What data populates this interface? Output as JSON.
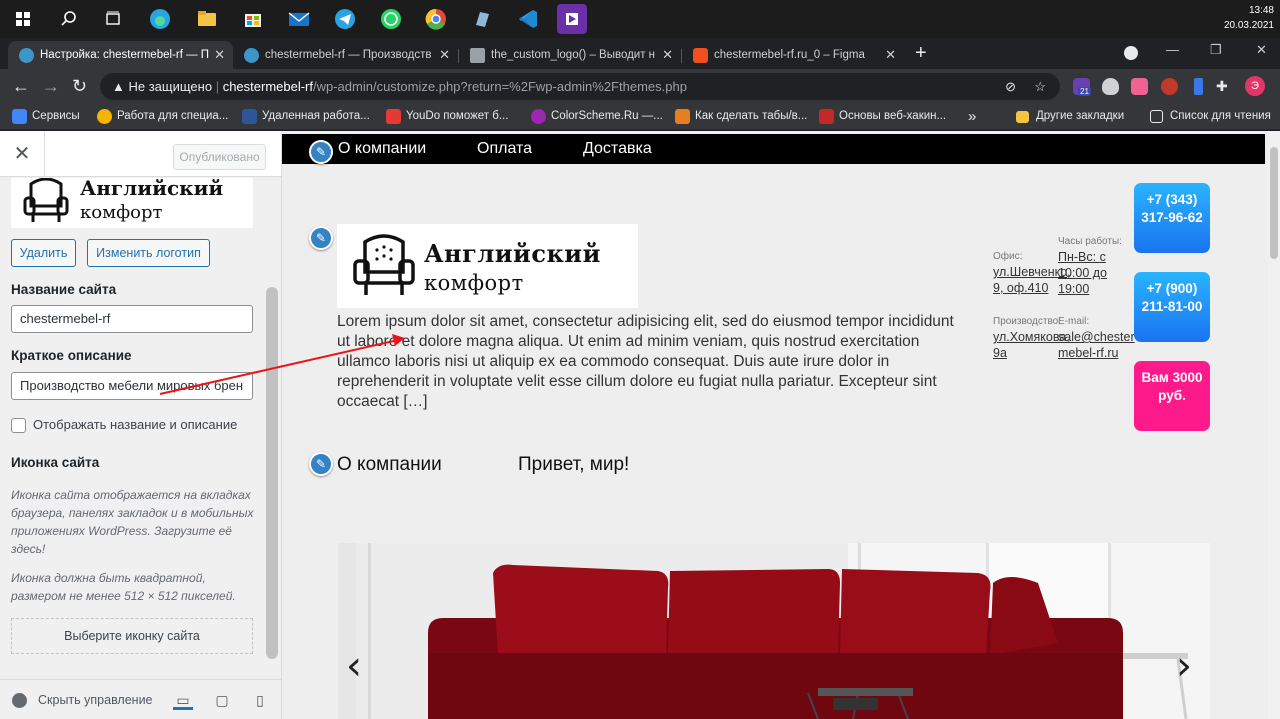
{
  "taskbar": {
    "time": "13:48",
    "date": "20.03.2021",
    "apps": [
      {
        "icon": "windows-start-icon",
        "color": "#ffffff"
      },
      {
        "icon": "search-icon",
        "color": "#ffffff"
      },
      {
        "icon": "task-view-icon",
        "color": "#ffffff"
      },
      {
        "icon": "edge-icon",
        "color": "#2ba5e0"
      },
      {
        "icon": "file-explorer-icon",
        "color": "#f5c443"
      },
      {
        "icon": "store-icon",
        "color": "#f0f0f0"
      },
      {
        "icon": "mail-icon",
        "color": "#1a73c8"
      },
      {
        "icon": "telegram-icon",
        "color": "#2aa3de"
      },
      {
        "icon": "whatsapp-icon",
        "color": "#25d366"
      },
      {
        "icon": "chrome-icon",
        "color": "#dd4b39"
      },
      {
        "icon": "notes-icon",
        "color": "#8fb8d8"
      },
      {
        "icon": "vscode-icon",
        "color": "#1f8ad2"
      },
      {
        "icon": "media-player-icon",
        "color": "#6b2fa8"
      }
    ]
  },
  "browser": {
    "tabs": [
      {
        "label": "Настройка: chestermebel-rf — П",
        "active": true,
        "fav_color": "#3c96c8"
      },
      {
        "label": "chestermebel-rf — Производств",
        "active": false,
        "fav_color": "#3c96c8"
      },
      {
        "label": "the_custom_logo() – Выводит н",
        "active": false,
        "fav_color": "#9aa0a6"
      },
      {
        "label": "chestermebel-rf.ru_0 – Figma",
        "active": false,
        "fav_color": "#f24e1e"
      }
    ],
    "new_tab_glyph": "+",
    "address": {
      "warning": "Не защищено",
      "host": "chestermebel-rf",
      "path": "/wp-admin/customize.php?return=%2Fwp-admin%2Fthemes.php"
    },
    "extensions": [
      {
        "icon": "extension-badge-icon",
        "color": "#6a3fb0",
        "badge": "21"
      },
      {
        "icon": "shield-ext-icon",
        "color": "#cfd1d4"
      },
      {
        "icon": "color-ext-icon",
        "color": "#f06292"
      },
      {
        "icon": "record-ext-icon",
        "color": "#c0392b"
      },
      {
        "icon": "blue-ext-icon",
        "color": "#3b78e7"
      },
      {
        "icon": "puzzle-icon",
        "color": "#e8eaed"
      },
      {
        "icon": "profile-avatar",
        "color": "#e2366b",
        "letter": "Э"
      }
    ],
    "bookmarks": [
      {
        "label": "Сервисы",
        "color": "#4285f4"
      },
      {
        "label": "Работа для специа...",
        "color": "#f4b400"
      },
      {
        "label": "Удаленная работа...",
        "color": "#2b5797"
      },
      {
        "label": "YouDo поможет б...",
        "color": "#e53935"
      },
      {
        "label": "ColorScheme.Ru —...",
        "color": "#9c27b0"
      },
      {
        "label": "Как сделать табы/в...",
        "color": "#e67e22"
      },
      {
        "label": "Основы веб-хакин...",
        "color": "#c62828"
      }
    ],
    "bookmarks_more": "»",
    "other_bookmarks": "Другие закладки",
    "reading_list": "Список для чтения"
  },
  "customizer": {
    "publish_label": "Опубликовано",
    "logo_line1": "Английский",
    "logo_line2": "комфорт",
    "remove_label": "Удалить",
    "change_logo_label": "Изменить логотип",
    "site_title_label": "Название сайта",
    "site_title_value": "chestermebel-rf",
    "tagline_label": "Краткое описание",
    "tagline_value": "Производство мебели мировых брен",
    "display_title_label": "Отображать название и описание",
    "site_icon_label": "Иконка сайта",
    "site_icon_desc1": "Иконка сайта отображается на вкладках браузера, панелях закладок и в мобильных приложениях WordPress. Загрузите её здесь!",
    "site_icon_desc2": "Иконка должна быть квадратной, размером не менее 512 × 512 пикселей.",
    "select_icon_label": "Выберите иконку сайта",
    "hide_controls_label": "Скрыть управление"
  },
  "preview": {
    "nav": [
      "О компании",
      "Оплата",
      "Доставка"
    ],
    "logo_line1": "Английский",
    "logo_line2": "комфорт",
    "lorem": "Lorem ipsum dolor sit amet, consectetur adipisicing elit, sed do eiusmod tempor incididunt ut labore et dolore magna aliqua. Ut enim ad minim veniam, quis nostrud exercitation ullamco laboris nisi ut aliquip ex ea commodo consequat. Duis aute irure dolor in reprehenderit in voluptate velit esse cillum dolore eu fugiat nulla pariatur. Excepteur sint occaecat […]",
    "office_label": "Офис:",
    "office_value": "ул.Шевченко, 9, оф.410",
    "hours_label": "Часы работы:",
    "hours_value": "Пн-Вс: с 10:00 до 19:00",
    "production_label": "Производство:",
    "production_value": "ул.Хомякова, 9а",
    "email_label": "E-mail:",
    "email_value": "sale@chestermebel-rf.ru",
    "phone1": "+7 (343) 317-96-62",
    "phone2": "+7 (900) 211-81-00",
    "promo": "Вам 3000 руб.",
    "sec_about": "О компании",
    "sec_hello": "Привет, мир!",
    "slider_prev": "‹",
    "slider_next": "›",
    "colors": {
      "cta_blue": "#1e90ff",
      "cta_pink": "#ff1493",
      "sofa_red": "#8b0a14"
    }
  }
}
